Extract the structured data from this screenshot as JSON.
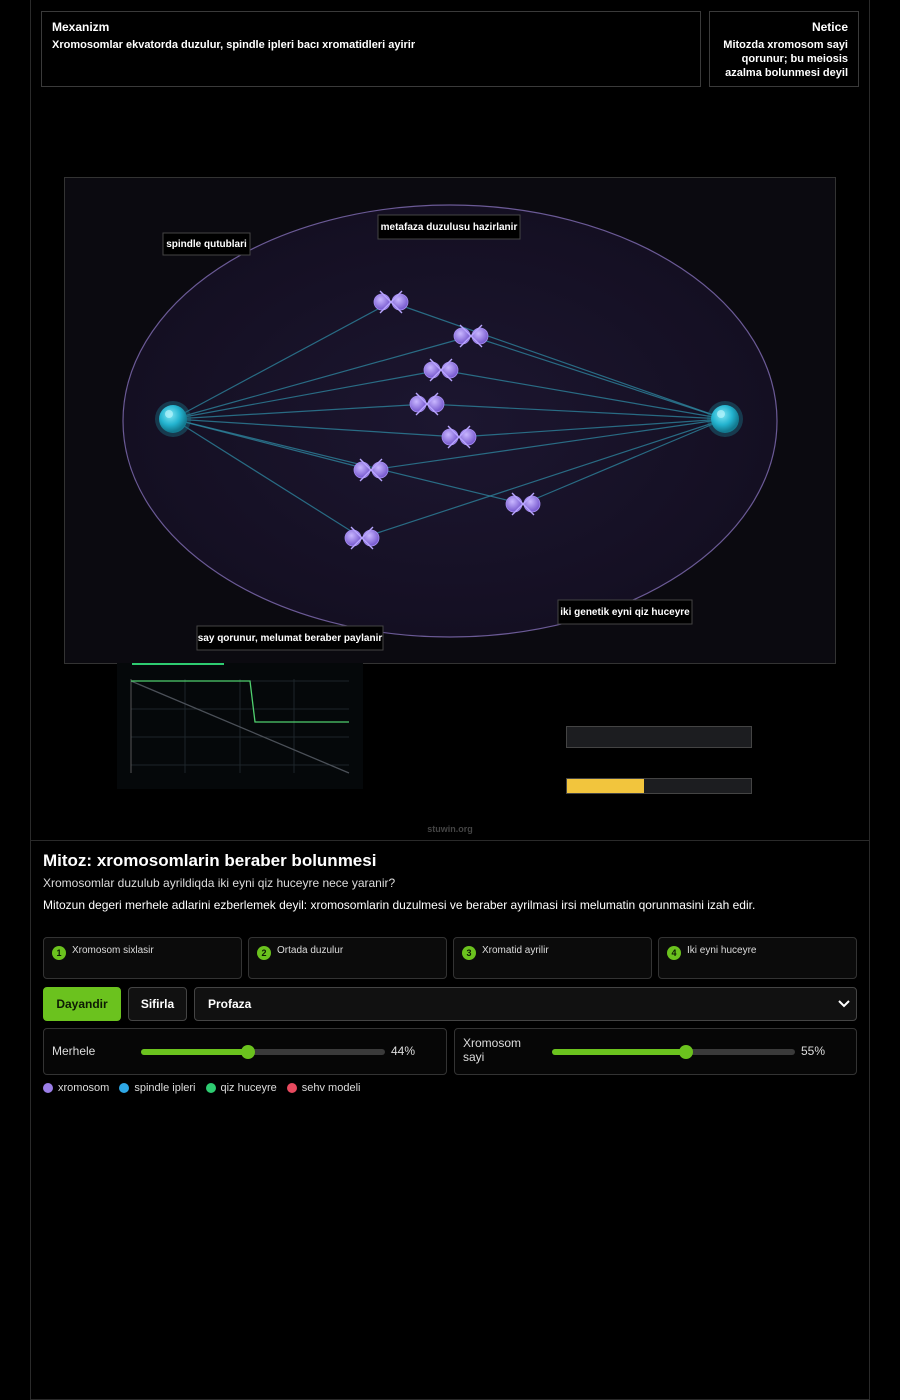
{
  "mechanism": {
    "title": "Mexanizm",
    "text": "Xromosomlar ekvatorda duzulur, spindle ipleri bacı xromatidleri ayirir"
  },
  "result": {
    "title": "Netice",
    "text": "Mitozda xromosom sayi qorunur; bu meiosis azalma bolunmesi deyil"
  },
  "sim": {
    "labels": {
      "poles": "spindle qutublari",
      "metaphase": "metafaza duzulusu hazirlanir",
      "count": "say qorunur, melumat beraber paylanir",
      "daughters": "iki genetik eyni qiz huceyre"
    }
  },
  "colors": {
    "accent": "#6bc21e",
    "chromosome": "#9b7ee8",
    "spindle": "#2ec6e6",
    "daughter": "#2ecc71",
    "error": "#e84a5f",
    "progress": "#f2c53d"
  },
  "progress_bar": {
    "value_percent": 42
  },
  "credit": "stuwin.org",
  "title": "Mitoz: xromosomlarin beraber bolunmesi",
  "subtitle": "Xromosomlar duzulub ayrildiqda iki eyni qiz huceyre nece yaranir?",
  "description": "Mitozun degeri merhele adlarini ezberlemek deyil: xromosomlarin duzulmesi ve beraber ayrilmasi irsi melumatin qorunmasini izah edir.",
  "steps": [
    {
      "num": "1",
      "label": "Xromosom sixlasir"
    },
    {
      "num": "2",
      "label": "Ortada duzulur"
    },
    {
      "num": "3",
      "label": "Xromatid ayrilir"
    },
    {
      "num": "4",
      "label": "Iki eyni huceyre"
    }
  ],
  "controls": {
    "pause_label": "Dayandir",
    "reset_label": "Sifirla",
    "phase_select": "Profaza",
    "stage": {
      "label": "Merhele",
      "value": 44,
      "display": "44%"
    },
    "chromosome_count": {
      "label": "Xromosom sayi",
      "value": 55,
      "display": "55%"
    }
  },
  "legend": [
    {
      "label": "xromosom",
      "color": "#9b7ee8"
    },
    {
      "label": "spindle ipleri",
      "color": "#2ea8e6"
    },
    {
      "label": "qiz huceyre",
      "color": "#2ecc71"
    },
    {
      "label": "sehv modeli",
      "color": "#e84a5f"
    }
  ]
}
